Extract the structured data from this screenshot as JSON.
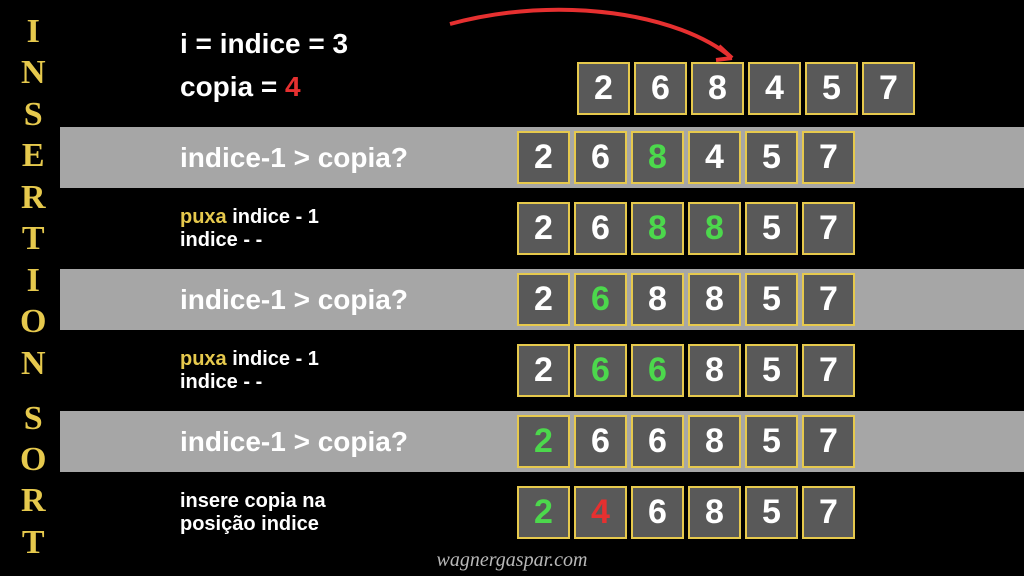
{
  "title": "INSERTION SORT",
  "top": {
    "line1": "i = indice = 3",
    "copia_prefix": "copia = ",
    "copia_value": "4"
  },
  "rows": [
    {
      "type": "grey",
      "label_html": [
        {
          "t": "indice-1 > copia?",
          "c": "w"
        }
      ],
      "size": "big",
      "cells": [
        {
          "v": "2"
        },
        {
          "v": "6"
        },
        {
          "v": "8",
          "c": "green"
        },
        {
          "v": "4"
        },
        {
          "v": "5"
        },
        {
          "v": "7"
        }
      ]
    },
    {
      "type": "black",
      "label_html": [
        {
          "t": "puxa",
          "c": "y"
        },
        {
          "t": " indice - 1",
          "c": "w"
        },
        {
          "br": true
        },
        {
          "t": "indice - -",
          "c": "w"
        }
      ],
      "size": "small",
      "cells": [
        {
          "v": "2"
        },
        {
          "v": "6"
        },
        {
          "v": "8",
          "c": "green"
        },
        {
          "v": "8",
          "c": "green"
        },
        {
          "v": "5"
        },
        {
          "v": "7"
        }
      ]
    },
    {
      "type": "grey",
      "label_html": [
        {
          "t": "indice-1 > copia?",
          "c": "w"
        }
      ],
      "size": "big",
      "cells": [
        {
          "v": "2"
        },
        {
          "v": "6",
          "c": "green"
        },
        {
          "v": "8"
        },
        {
          "v": "8"
        },
        {
          "v": "5"
        },
        {
          "v": "7"
        }
      ]
    },
    {
      "type": "black",
      "label_html": [
        {
          "t": "puxa",
          "c": "y"
        },
        {
          "t": " indice - 1",
          "c": "w"
        },
        {
          "br": true
        },
        {
          "t": "indice - -",
          "c": "w"
        }
      ],
      "size": "small",
      "cells": [
        {
          "v": "2"
        },
        {
          "v": "6",
          "c": "green"
        },
        {
          "v": "6",
          "c": "green"
        },
        {
          "v": "8"
        },
        {
          "v": "5"
        },
        {
          "v": "7"
        }
      ]
    },
    {
      "type": "grey",
      "label_html": [
        {
          "t": "indice-1 > copia?",
          "c": "w"
        }
      ],
      "size": "big",
      "cells": [
        {
          "v": "2",
          "c": "green"
        },
        {
          "v": "6"
        },
        {
          "v": "6"
        },
        {
          "v": "8"
        },
        {
          "v": "5"
        },
        {
          "v": "7"
        }
      ]
    },
    {
      "type": "black",
      "label_html": [
        {
          "t": "insere copia na",
          "c": "w"
        },
        {
          "br": true
        },
        {
          "t": "posição indice",
          "c": "w"
        }
      ],
      "size": "small",
      "cells": [
        {
          "v": "2",
          "c": "green"
        },
        {
          "v": "4",
          "c": "red"
        },
        {
          "v": "6"
        },
        {
          "v": "8"
        },
        {
          "v": "5"
        },
        {
          "v": "7"
        }
      ]
    }
  ],
  "top_array": [
    {
      "v": "2"
    },
    {
      "v": "6"
    },
    {
      "v": "8"
    },
    {
      "v": "4"
    },
    {
      "v": "5"
    },
    {
      "v": "7"
    }
  ],
  "footer": "wagnergaspar.com",
  "chart_data": {
    "type": "table",
    "title": "Insertion Sort step trace (i=3, copia=4)",
    "initial": [
      2,
      6,
      8,
      4,
      5,
      7
    ],
    "steps": [
      {
        "desc": "indice-1 > copia?",
        "array": [
          2,
          6,
          8,
          4,
          5,
          7
        ],
        "highlight": [
          2
        ]
      },
      {
        "desc": "puxa indice-1; indice--",
        "array": [
          2,
          6,
          8,
          8,
          5,
          7
        ],
        "highlight": [
          2,
          3
        ]
      },
      {
        "desc": "indice-1 > copia?",
        "array": [
          2,
          6,
          8,
          8,
          5,
          7
        ],
        "highlight": [
          1
        ]
      },
      {
        "desc": "puxa indice-1; indice--",
        "array": [
          2,
          6,
          6,
          8,
          5,
          7
        ],
        "highlight": [
          1,
          2
        ]
      },
      {
        "desc": "indice-1 > copia?",
        "array": [
          2,
          6,
          6,
          8,
          5,
          7
        ],
        "highlight": [
          0
        ]
      },
      {
        "desc": "insere copia na posição indice",
        "array": [
          2,
          4,
          6,
          8,
          5,
          7
        ],
        "highlight": [
          0,
          1
        ]
      }
    ]
  }
}
